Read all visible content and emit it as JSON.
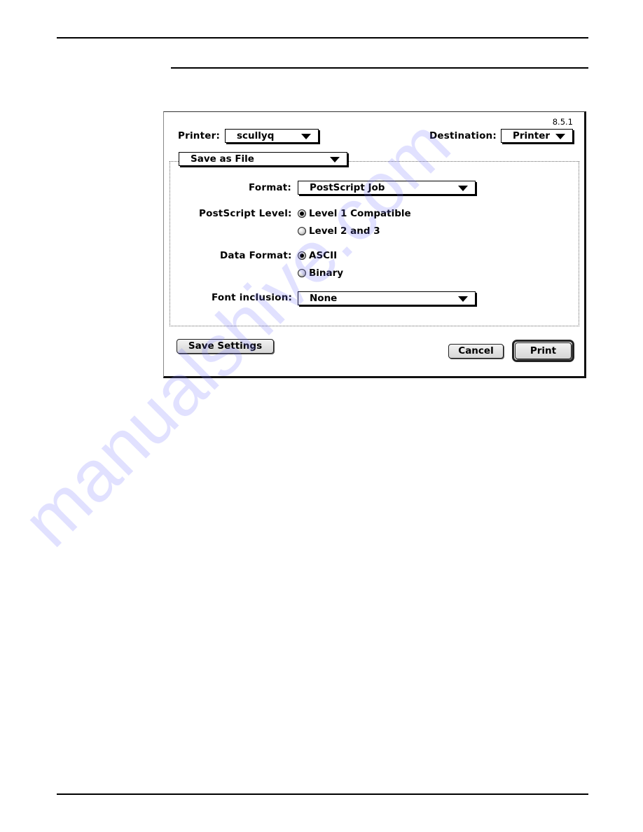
{
  "page": {
    "watermark": "manualshive.com"
  },
  "dialog": {
    "version": "8.5.1",
    "printer_label": "Printer:",
    "printer_value": "scullyq",
    "destination_label": "Destination:",
    "destination_value": "Printer",
    "panel_value": "Save as File",
    "format_label": "Format:",
    "format_value": "PostScript Job",
    "postscript_level_label": "PostScript Level:",
    "postscript_level_options": [
      {
        "label": "Level 1 Compatible",
        "selected": true
      },
      {
        "label": "Level 2 and 3",
        "selected": false
      }
    ],
    "data_format_label": "Data Format:",
    "data_format_options": [
      {
        "label": "ASCII",
        "selected": true
      },
      {
        "label": "Binary",
        "selected": false
      }
    ],
    "font_inclusion_label": "Font inclusion:",
    "font_inclusion_value": "None",
    "save_settings_label": "Save Settings",
    "cancel_label": "Cancel",
    "print_label": "Print"
  }
}
